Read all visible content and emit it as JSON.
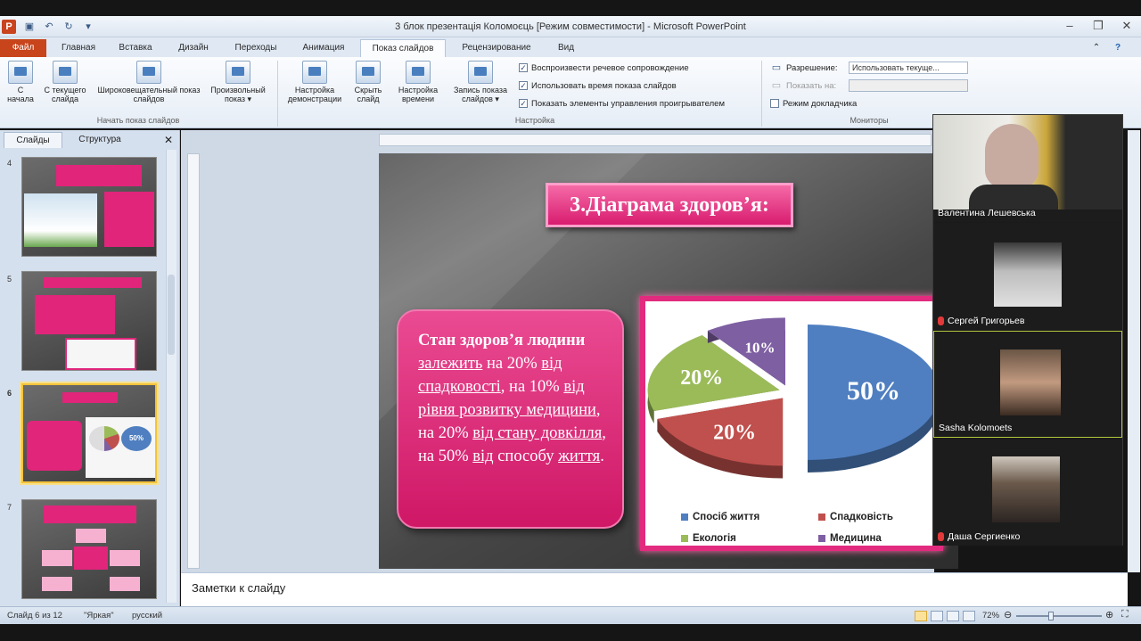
{
  "app": {
    "window_title": "3 блок презентація Коломоєць [Режим совместимости] - Microsoft PowerPoint",
    "logo_letter": "P"
  },
  "ribbon": {
    "file_tab": "Файл",
    "tabs": [
      "Главная",
      "Вставка",
      "Дизайн",
      "Переходы",
      "Анимация",
      "Показ слайдов",
      "Рецензирование",
      "Вид"
    ],
    "active_tab_index": 5,
    "groups": {
      "start": {
        "label": "Начать показ слайдов",
        "buttons": [
          "С начала",
          "С текущего слайда",
          "Широковещательный показ слайдов",
          "Произвольный показ ▾"
        ]
      },
      "setup": {
        "label": "Настройка",
        "buttons": [
          "Настройка демонстрации",
          "Скрыть слайд",
          "Настройка времени",
          "Запись показа слайдов ▾"
        ],
        "checkboxes": [
          "Воспроизвести речевое сопровождение",
          "Использовать время показа слайдов",
          "Показать элементы управления проигрывателем"
        ]
      },
      "monitors": {
        "label": "Мониторы",
        "resolution_label": "Разрешение:",
        "resolution_value": "Использовать текуще...",
        "show_on_label": "Показать на:",
        "presenter_view": "Режим докладчика"
      }
    }
  },
  "left_pane": {
    "tabs": [
      "Слайды",
      "Структура"
    ],
    "slides": [
      {
        "num": "4"
      },
      {
        "num": "5"
      },
      {
        "num": "6",
        "selected": true,
        "pie_label": "50%"
      },
      {
        "num": "7"
      }
    ]
  },
  "slide": {
    "title": "3.Діаграма здоров’я:",
    "text_parts": [
      {
        "t": "Стан здоров’я людини ",
        "b": true,
        "u": false
      },
      {
        "t": "залежить",
        "b": false,
        "u": true
      },
      {
        "t": " на 20% ",
        "b": false,
        "u": false
      },
      {
        "t": "від спадковості",
        "b": false,
        "u": true
      },
      {
        "t": ", на 10% ",
        "b": false,
        "u": false
      },
      {
        "t": "від рівня розвитку медицини",
        "b": false,
        "u": true
      },
      {
        "t": ", на 20% ",
        "b": false,
        "u": false
      },
      {
        "t": "від стану довкілля",
        "b": false,
        "u": true
      },
      {
        "t": ", на 50% ",
        "b": false,
        "u": false
      },
      {
        "t": "від",
        "b": false,
        "u": true
      },
      {
        "t": " способу ",
        "b": false,
        "u": false
      },
      {
        "t": "життя",
        "b": false,
        "u": true
      },
      {
        "t": ".",
        "b": false,
        "u": false
      }
    ]
  },
  "chart_data": {
    "type": "pie",
    "categories": [
      "Спосіб життя",
      "Спадковість",
      "Екологія",
      "Медицина"
    ],
    "values": [
      50,
      20,
      20,
      10
    ],
    "labels": [
      "50%",
      "20%",
      "20%",
      "10%"
    ],
    "colors": [
      "#4f7fc0",
      "#c0504d",
      "#9bbb59",
      "#7e5fa2"
    ],
    "legend_position": "bottom"
  },
  "participants": [
    {
      "name": "Валентина Лешевська",
      "muted": false
    },
    {
      "name": "Сергей Григорьев",
      "muted": true
    },
    {
      "name": "Sasha Kolomoets",
      "muted": false,
      "active": true
    },
    {
      "name": "Даша Сергиенко",
      "muted": true
    }
  ],
  "notes": {
    "placeholder": "Заметки к слайду"
  },
  "status": {
    "slide_info": "Слайд 6 из 12",
    "theme": "\"Яркая\"",
    "language": "русский",
    "zoom": "72%"
  }
}
